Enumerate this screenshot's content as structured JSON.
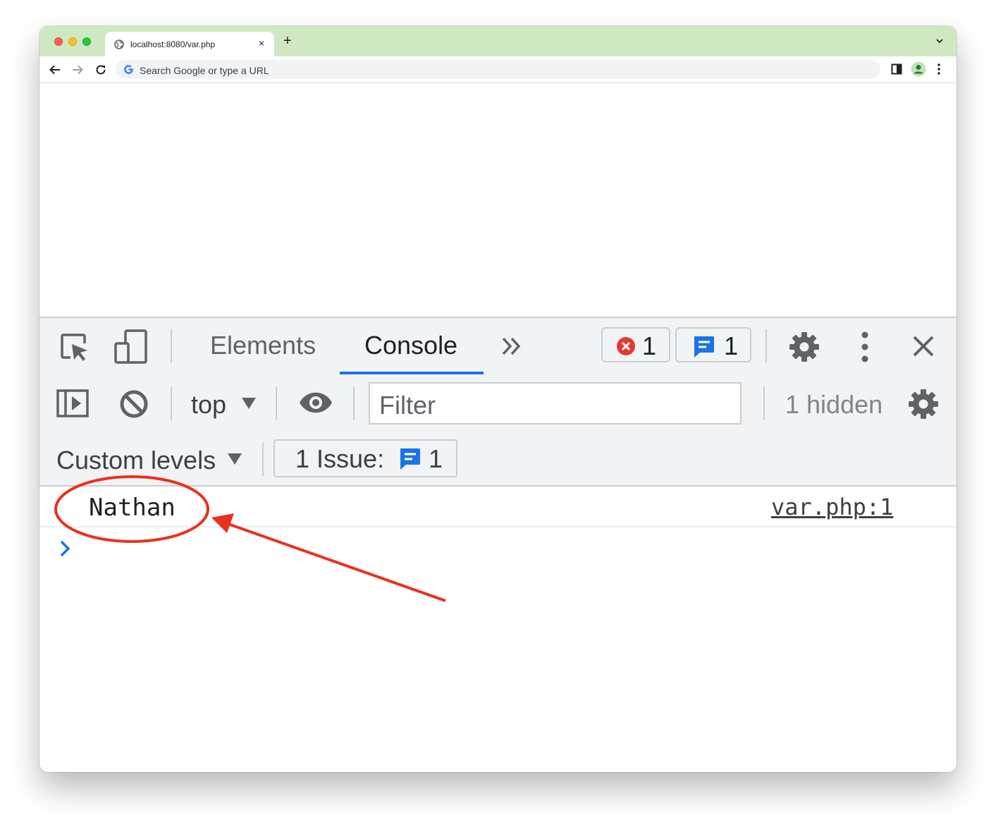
{
  "browser": {
    "tab_title": "localhost:8080/var.php",
    "tab_close": "×",
    "new_tab": "+",
    "omnibox_placeholder": "Search Google or type a URL"
  },
  "devtools": {
    "tabs": [
      "Elements",
      "Console"
    ],
    "active_tab": "Console",
    "error_count": "1",
    "message_count": "1",
    "context_selector": "top",
    "filter_placeholder": "Filter",
    "hidden_count": "1 hidden",
    "levels_selector": "Custom levels",
    "issues_label": "1 Issue:",
    "issues_count": "1"
  },
  "console": {
    "messages": [
      {
        "text": "Nathan",
        "source": "var.php:1"
      }
    ]
  },
  "colors": {
    "tabstrip": "#cfe8c2",
    "accent_blue": "#1a73e8",
    "error_red": "#e53935",
    "annotation_red": "#e8321e"
  }
}
